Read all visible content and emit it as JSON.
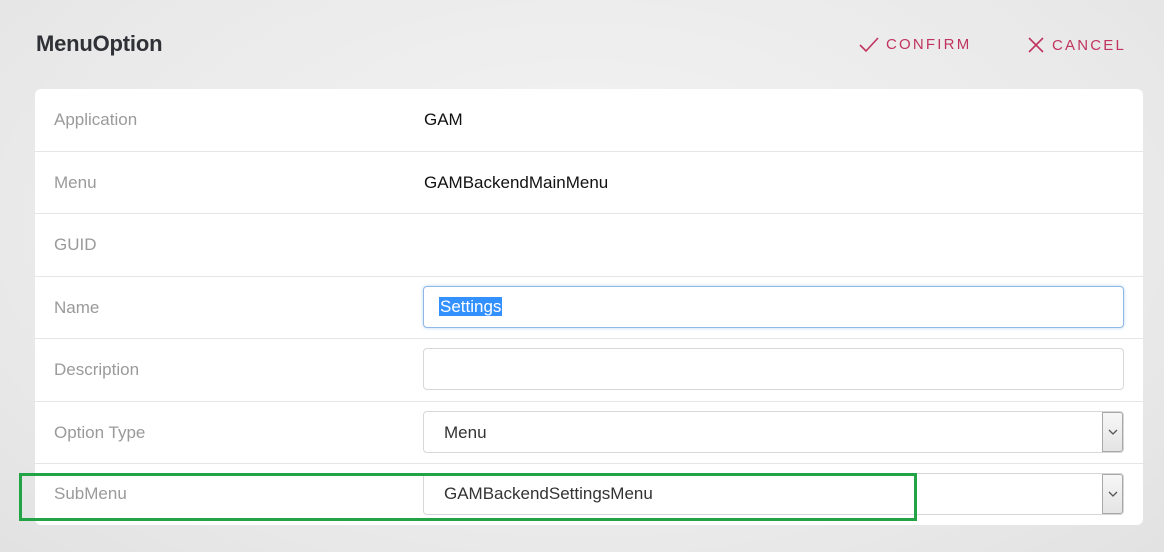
{
  "header": {
    "title": "MenuOption",
    "confirm_label": "CONFIRM",
    "cancel_label": "CANCEL"
  },
  "form": {
    "application": {
      "label": "Application",
      "value": "GAM"
    },
    "menu": {
      "label": "Menu",
      "value": "GAMBackendMainMenu"
    },
    "guid": {
      "label": "GUID",
      "value": ""
    },
    "name": {
      "label": "Name",
      "value": "Settings"
    },
    "description": {
      "label": "Description",
      "value": ""
    },
    "option_type": {
      "label": "Option Type",
      "value": "Menu"
    },
    "submenu": {
      "label": "SubMenu",
      "value": "GAMBackendSettingsMenu"
    }
  },
  "colors": {
    "accent": "#c0345f",
    "highlight": "#22a446",
    "selection": "#3390ff"
  },
  "icons": {
    "confirm": "check-icon",
    "cancel": "close-icon",
    "select": "chevron-down-icon"
  }
}
